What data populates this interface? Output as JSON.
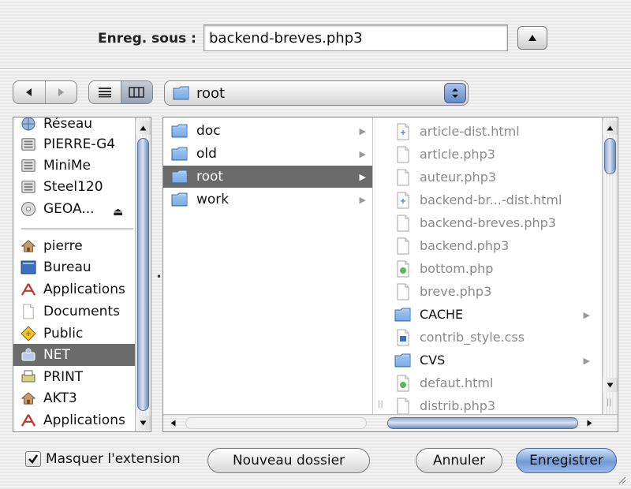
{
  "save": {
    "label": "Enreg. sous :",
    "filename": "backend-breves.php3"
  },
  "path_popup": {
    "label": "root"
  },
  "sidebar": {
    "devices": [
      {
        "label": "Réseau",
        "icon": "network-icon"
      },
      {
        "label": "PIERRE-G4",
        "icon": "computer-icon"
      },
      {
        "label": "MiniMe",
        "icon": "computer-icon"
      },
      {
        "label": "Steel120",
        "icon": "computer-icon"
      },
      {
        "label": "GEOA...",
        "icon": "cd-icon"
      }
    ],
    "places": [
      {
        "label": "pierre",
        "icon": "home-icon"
      },
      {
        "label": "Bureau",
        "icon": "desktop-icon"
      },
      {
        "label": "Applications",
        "icon": "applications-icon"
      },
      {
        "label": "Documents",
        "icon": "documents-icon"
      },
      {
        "label": "Public",
        "icon": "public-icon"
      },
      {
        "label": "NET",
        "icon": "network-drive-icon"
      },
      {
        "label": "PRINT",
        "icon": "printer-icon"
      },
      {
        "label": "AKT3",
        "icon": "home-icon"
      },
      {
        "label": "Applications",
        "icon": "applications-icon"
      }
    ]
  },
  "column1": [
    {
      "label": "doc"
    },
    {
      "label": "old"
    },
    {
      "label": "root"
    },
    {
      "label": "work"
    }
  ],
  "column2": [
    {
      "label": "article-dist.html",
      "type": "html"
    },
    {
      "label": "article.php3",
      "type": "doc"
    },
    {
      "label": "auteur.php3",
      "type": "doc"
    },
    {
      "label": "backend-br...-dist.html",
      "type": "html"
    },
    {
      "label": "backend-breves.php3",
      "type": "doc"
    },
    {
      "label": "backend.php3",
      "type": "doc"
    },
    {
      "label": "bottom.php",
      "type": "green"
    },
    {
      "label": "breve.php3",
      "type": "doc"
    },
    {
      "label": "CACHE",
      "type": "folder"
    },
    {
      "label": "contrib_style.css",
      "type": "css"
    },
    {
      "label": "CVS",
      "type": "folder"
    },
    {
      "label": "defaut.html",
      "type": "green"
    },
    {
      "label": "distrib.php3",
      "type": "doc"
    }
  ],
  "options": {
    "hide_extension_label": "Masquer l'extension"
  },
  "buttons": {
    "new_folder": "Nouveau dossier",
    "cancel": "Annuler",
    "save": "Enregistrer"
  },
  "colors": {
    "selection": "#6b6b6b",
    "aqua_blue": "#6f9bd8",
    "folder_blue": "#7fb0e8"
  }
}
